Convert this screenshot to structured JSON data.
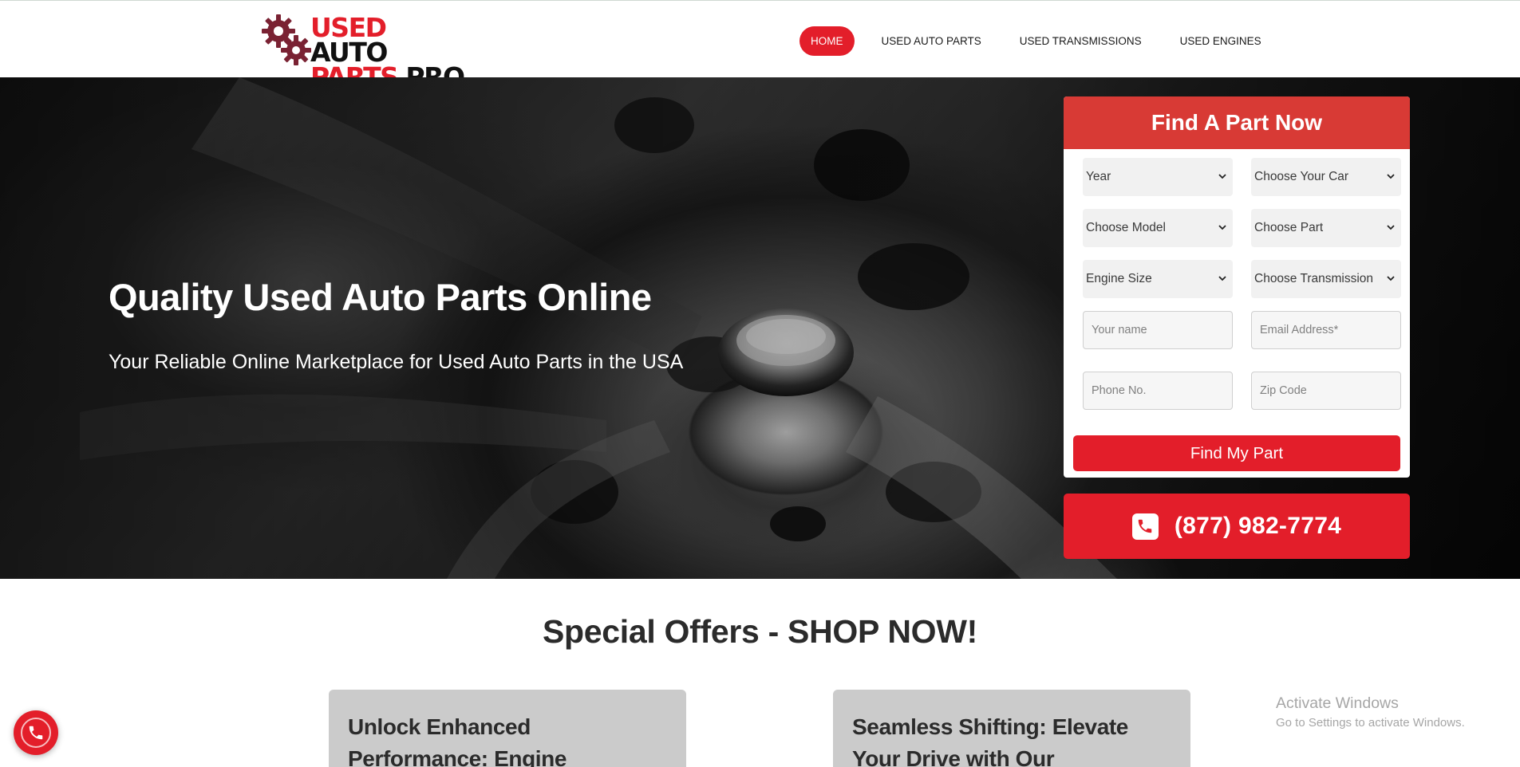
{
  "brand": {
    "line1_red": "USED",
    "line1_dark": "AUTO",
    "line2_red": "PARTS",
    "line2_dark": "PRO",
    "red_color": "#e31e2a",
    "gear_color": "#7a2233"
  },
  "nav": {
    "items": [
      {
        "label": "HOME",
        "active": true
      },
      {
        "label": "USED AUTO PARTS",
        "active": false
      },
      {
        "label": "USED TRANSMISSIONS",
        "active": false
      },
      {
        "label": "USED ENGINES",
        "active": false
      }
    ]
  },
  "hero": {
    "title": "Quality Used Auto Parts Online",
    "subtitle": "Your Reliable Online Marketplace for Used Auto Parts in the USA"
  },
  "form": {
    "heading": "Find A Part Now",
    "selects": {
      "year": "Year",
      "car": "Choose Your Car",
      "model": "Choose Model",
      "part": "Choose Part",
      "engine": "Engine Size",
      "transmission": "Choose Transmission"
    },
    "inputs": {
      "name": "Your name",
      "email": "Email Address*",
      "phone": "Phone No.",
      "zip": "Zip Code"
    },
    "submit_label": "Find My Part"
  },
  "phone_cta": {
    "number": "(877) 982-7774",
    "icon": "phone-icon"
  },
  "offers": {
    "title": "Special Offers - SHOP NOW!",
    "cards": [
      {
        "title": "Unlock Enhanced Performance: Engine"
      },
      {
        "title": "Seamless Shifting: Elevate Your Drive with Our"
      }
    ]
  },
  "watermark": {
    "line1": "Activate Windows",
    "line2": "Go to Settings to activate Windows."
  },
  "floating_call": {
    "icon": "phone-ring-icon"
  }
}
